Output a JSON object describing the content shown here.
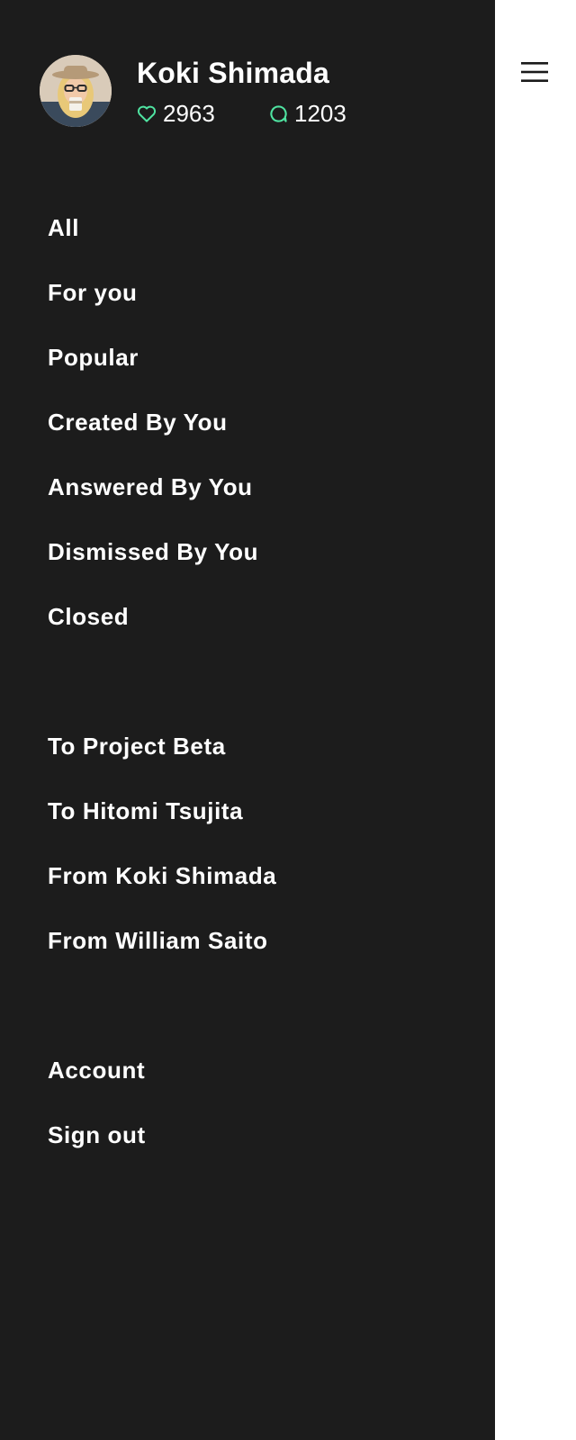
{
  "profile": {
    "name": "Koki Shimada",
    "likes": "2963",
    "comments": "1203"
  },
  "icons": {
    "likes": "heart-icon",
    "comments": "speech-bubble-icon",
    "menu": "hamburger-menu-icon"
  },
  "colors": {
    "drawer_background": "#1c1c1c",
    "text": "#ffffff",
    "accent": "#4fe3a1",
    "page_background": "#ffffff"
  },
  "nav": {
    "filters": [
      "All",
      "For you",
      "Popular",
      "Created By You",
      "Answered By You",
      "Dismissed By You",
      "Closed"
    ],
    "people": [
      "To Project Beta",
      "To Hitomi Tsujita",
      "From Koki Shimada",
      "From William Saito"
    ],
    "account": [
      "Account",
      "Sign out"
    ]
  }
}
